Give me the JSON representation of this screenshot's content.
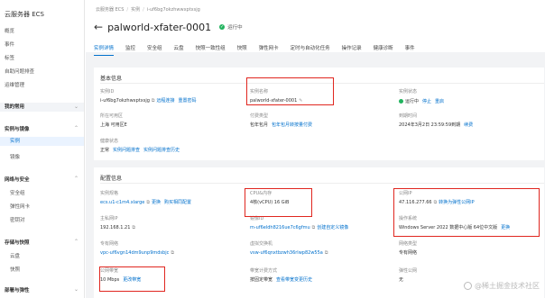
{
  "sidebar": {
    "title": "云服务器 ECS",
    "items": [
      {
        "label": "概览"
      },
      {
        "label": "事件"
      },
      {
        "label": "标签"
      },
      {
        "label": "自助问题排查"
      },
      {
        "label": "运维管理"
      },
      {
        "label": "我的常用"
      },
      {
        "label": "实例与镜像"
      },
      {
        "label": "实例"
      },
      {
        "label": "镜像"
      },
      {
        "label": "网络与安全"
      },
      {
        "label": "安全组"
      },
      {
        "label": "弹性网卡"
      },
      {
        "label": "密钥对"
      },
      {
        "label": "存储与快照"
      },
      {
        "label": "云盘"
      },
      {
        "label": "快照"
      },
      {
        "label": "部署与弹性"
      }
    ]
  },
  "header": {
    "breadcrumb": [
      "云服务器 ECS",
      "实例",
      "i-uf6bg7okzhwwxptxsjg"
    ],
    "title": "palworld-xfater-0001",
    "status": "运行中"
  },
  "tabs": [
    "实例详情",
    "监控",
    "安全组",
    "云盘",
    "快照一致性组",
    "快照",
    "弹性网卡",
    "定时与自动化任务",
    "操作记录",
    "健康诊断",
    "事件"
  ],
  "basic": {
    "title": "基本信息",
    "instance_id_label": "实例ID",
    "instance_id": "i-uf6bg7okzhwxptxsjg",
    "remote_connect": "远程连接",
    "reset_password": "重置密码",
    "name_label": "实例名称",
    "name_value": "palworld-xfater-0001",
    "state_label": "实例状态",
    "state_value": "运行中",
    "stop": "停止",
    "restart": "重启",
    "region_label": "所在可用区",
    "region_value": "上海 可用区E",
    "billing_label": "付费类型",
    "billing_value": "包年包月",
    "billing_link": "包年包月转按量付费",
    "expire_label": "到期时间",
    "expire_value": "2024年3月2日 23:59:59到期",
    "renew": "续费",
    "health_label": "健康状态",
    "health_value": "正常",
    "health_link1": "实例问题排查",
    "health_link2": "实例问题排查历史"
  },
  "config": {
    "title": "配置信息",
    "spec_label": "实例规格",
    "spec_value": "ecs.u1-c1m4.xlarge",
    "change_spec": "更换",
    "spec_history": "购买相同配置",
    "cpu_label": "CPU&内存",
    "cpu_value": "4核(vCPU) 16 GiB",
    "public_ip_label": "公网IP",
    "public_ip_value": "47.116.277.66",
    "public_ip_link": "转换为弹性公网IP",
    "private_ip_label": "主私网IP",
    "private_ip_value": "192.168.1.21",
    "image_label": "镜像ID",
    "image_value": "m-uf6eldh8216ue7c6gfmu",
    "image_link": "创建自定义镜像",
    "os_label": "操作系统",
    "os_value": "Windows Server 2022 数据中心版 64位中文版",
    "os_link": "更换",
    "vpc_label": "专有网络",
    "vpc_value": "vpc-uf6vgn14dm9unp9mdsbjc",
    "vswitch_label": "虚拟交换机",
    "vswitch_value": "vsw-uf6qnxtbzwh36rlwp82w55a",
    "network_label": "网络类型",
    "network_value": "专有网络",
    "bandwidth_label": "公网带宽",
    "bandwidth_value": "10 Mbps",
    "bandwidth_link": "更改带宽",
    "bw_billing_label": "带宽计费方式",
    "bw_billing_value": "按固定带宽",
    "bw_billing_link": "查看带宽变更历史",
    "nat_label": "弹性公网",
    "nat_value": "无"
  },
  "watermark": "@稀土掘金技术社区",
  "colors": {
    "accent": "#0070cc",
    "highlight_box": "#e0261f",
    "running": "#21b35e"
  }
}
